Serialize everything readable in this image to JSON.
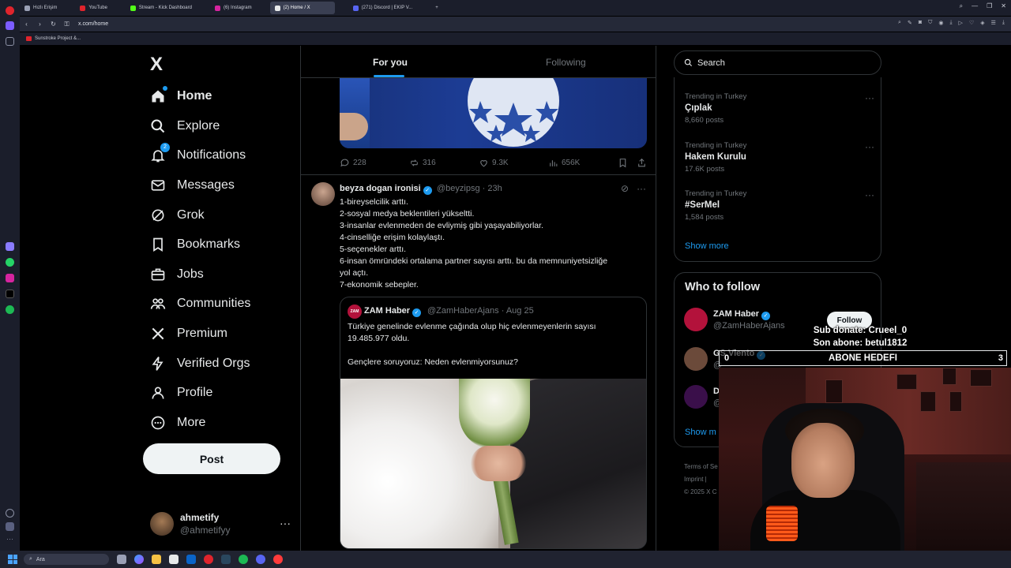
{
  "browser": {
    "tabs": [
      {
        "label": "Hızlı Erişim",
        "color": "#9aa0b5",
        "active": false
      },
      {
        "label": "YouTube",
        "color": "#e0242c",
        "active": false
      },
      {
        "label": "Stream - Kick Dashboard",
        "color": "#53fc18",
        "active": false
      },
      {
        "label": "(6) Instagram",
        "color": "#d6249f",
        "active": false
      },
      {
        "label": "(2) Home / X",
        "color": "#e7e9ea",
        "active": true
      },
      {
        "label": "(271) Discord | EKIP V...",
        "color": "#5865f2",
        "active": false
      }
    ],
    "new_tab": "+",
    "url": "x.com/home",
    "bookmark": "Sunstroke Project &..."
  },
  "nav": {
    "logo": "X",
    "notifications_badge": "2",
    "items": [
      {
        "label": "Home",
        "icon": "home-icon"
      },
      {
        "label": "Explore",
        "icon": "search-icon"
      },
      {
        "label": "Notifications",
        "icon": "bell-icon"
      },
      {
        "label": "Messages",
        "icon": "envelope-icon"
      },
      {
        "label": "Grok",
        "icon": "grok-icon"
      },
      {
        "label": "Bookmarks",
        "icon": "bookmark-icon"
      },
      {
        "label": "Jobs",
        "icon": "briefcase-icon"
      },
      {
        "label": "Communities",
        "icon": "people-icon"
      },
      {
        "label": "Premium",
        "icon": "x-icon"
      },
      {
        "label": "Verified Orgs",
        "icon": "lightning-icon"
      },
      {
        "label": "Profile",
        "icon": "person-icon"
      },
      {
        "label": "More",
        "icon": "more-circle-icon"
      }
    ],
    "post_label": "Post",
    "account": {
      "name": "ahmetify",
      "handle": "@ahmetifyy",
      "more": "···"
    }
  },
  "feed": {
    "tab_for_you": "For you",
    "tab_following": "Following",
    "prev_actions": {
      "replies": "228",
      "reposts": "316",
      "likes": "9.3K",
      "views": "656K"
    },
    "tweet": {
      "name": "beyza dogan ironisi",
      "handle": "@beyzipsg",
      "time": "· 23h",
      "lines": [
        "1-bireyselcilik arttı.",
        "2-sosyal medya beklentileri yükseltti.",
        "3-insanlar evlenmeden de evliymiş gibi yaşayabiliyorlar.",
        "4-cinselliğe erişim kolaylaştı.",
        "5-seçenekler arttı.",
        "6-insan ömründeki ortalama partner sayısı arttı. bu da memnuniyetsizliğe",
        "yol açtı.",
        "7-ekonomik sebepler."
      ],
      "quote": {
        "logo": "ZAM",
        "name": "ZAM Haber",
        "handle": "@ZamHaberAjans",
        "time": "· Aug 25",
        "text1": "Türkiye genelinde evlenme çağında olup hiç evlenmeyenlerin sayısı",
        "text2": "19.485.977 oldu.",
        "text3": "Gençlere soruyoruz: Neden evlenmiyorsunuz?"
      }
    }
  },
  "sidebar": {
    "search_placeholder": "Search",
    "trends": [
      {
        "context": "Trending in Turkey",
        "name": "Çıplak",
        "posts": "8,660 posts"
      },
      {
        "context": "Trending in Turkey",
        "name": "Hakem Kurulu",
        "posts": "17.6K posts"
      },
      {
        "context": "Trending in Turkey",
        "name": "#SerMel",
        "posts": "1,584 posts"
      }
    ],
    "trend_more": "···",
    "show_more": "Show more",
    "who_to_follow": {
      "title": "Who to follow",
      "users": [
        {
          "name": "ZAM Haber",
          "handle": "@ZamHaberAjans",
          "color": "#b3123b"
        },
        {
          "name": "GS Viento",
          "handle": "@",
          "color": "#6b4a3a"
        },
        {
          "name": "D",
          "handle": "@",
          "color": "#3a0f4a"
        }
      ],
      "follow_label": "Follow",
      "show_more": "Show m"
    },
    "footer": [
      "Terms of Se",
      "Imprint |",
      "© 2025 X C"
    ]
  },
  "overlay": {
    "sub_donate": "Sub donate: Crueel_0",
    "son_abone": "Son abone: betul1812",
    "goal_label": "ABONE HEDEFI",
    "goal_current": "0",
    "goal_target": "3",
    "goal_progress": 0
  },
  "taskbar": {
    "search_label": "Ara"
  }
}
